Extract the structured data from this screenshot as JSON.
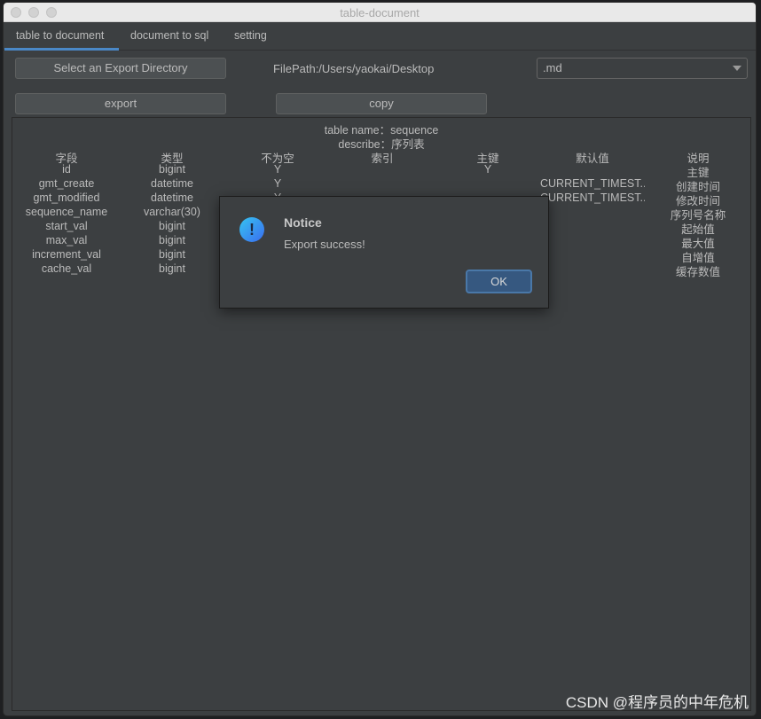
{
  "window": {
    "title": "table-document"
  },
  "tabs": [
    {
      "label": "table to document",
      "active": true
    },
    {
      "label": "document to sql"
    },
    {
      "label": "setting"
    }
  ],
  "toolbar": {
    "select_dir_label": "Select an Export Directory",
    "filepath": "FilePath:/Users/yaokai/Desktop",
    "format": ".md",
    "export_label": "export",
    "copy_label": "copy"
  },
  "table": {
    "name_line": "table name：sequence",
    "describe_line": "describe：序列表",
    "headers": [
      "字段",
      "类型",
      "不为空",
      "索引",
      "主键",
      "默认值",
      "说明"
    ],
    "rows": [
      [
        "id",
        "bigint",
        "Y",
        "",
        "Y",
        "",
        "主键"
      ],
      [
        "gmt_create",
        "datetime",
        "Y",
        "",
        "",
        "CURRENT_TIMEST...",
        "创建时间"
      ],
      [
        "gmt_modified",
        "datetime",
        "Y",
        "",
        "",
        "CURRENT_TIMEST...",
        "修改时间"
      ],
      [
        "sequence_name",
        "varchar(30)",
        "",
        "",
        "",
        "",
        "序列号名称"
      ],
      [
        "start_val",
        "bigint",
        "",
        "",
        "",
        "",
        "起始值"
      ],
      [
        "max_val",
        "bigint",
        "",
        "",
        "",
        "",
        "最大值"
      ],
      [
        "increment_val",
        "bigint",
        "",
        "",
        "",
        "",
        "自增值"
      ],
      [
        "cache_val",
        "bigint",
        "",
        "",
        "",
        "",
        "缓存数值"
      ]
    ]
  },
  "dialog": {
    "title": "Notice",
    "message": "Export success!",
    "ok_label": "OK",
    "icon": "exclamation-icon",
    "icon_text": "!"
  },
  "watermark": "CSDN @程序员的中年危机",
  "colors": {
    "accent": "#4a88c7",
    "background": "#3c3f41",
    "ok_button": "#365880"
  }
}
